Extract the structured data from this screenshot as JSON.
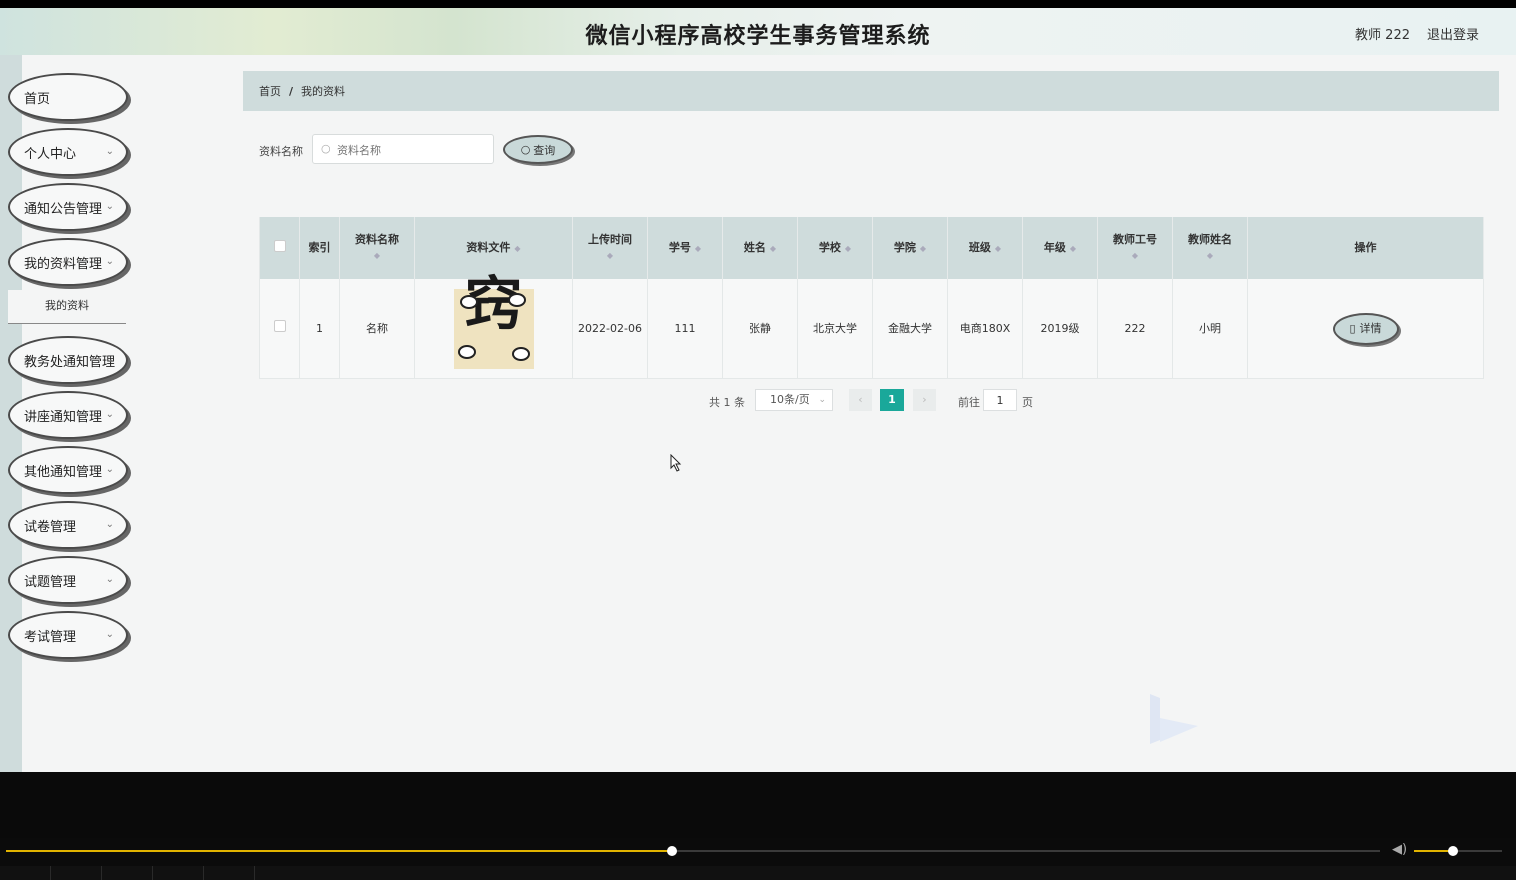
{
  "header": {
    "title": "微信小程序高校学生事务管理系统",
    "user": "教师 222",
    "logout": "退出登录"
  },
  "sidebar": {
    "items": [
      {
        "label": "首页",
        "has_children": false
      },
      {
        "label": "个人中心",
        "has_children": true
      },
      {
        "label": "通知公告管理",
        "has_children": true
      },
      {
        "label": "我的资料管理",
        "has_children": true
      },
      {
        "label": "教务处通知管理",
        "has_children": true
      },
      {
        "label": "讲座通知管理",
        "has_children": true
      },
      {
        "label": "其他通知管理",
        "has_children": true
      },
      {
        "label": "试卷管理",
        "has_children": true
      },
      {
        "label": "试题管理",
        "has_children": true
      },
      {
        "label": "考试管理",
        "has_children": true
      }
    ],
    "submenu": {
      "label": "我的资料"
    }
  },
  "breadcrumb": {
    "home": "首页",
    "separator": "/",
    "current": "我的资料"
  },
  "search": {
    "label": "资料名称",
    "placeholder": "资料名称",
    "button": "查询"
  },
  "table": {
    "headers": [
      "索引",
      "资料名称",
      "资料文件",
      "上传时间",
      "学号",
      "姓名",
      "学校",
      "学院",
      "班级",
      "年级",
      "教师工号",
      "教师姓名",
      "操作"
    ],
    "rows": [
      {
        "index": "1",
        "name": "名称",
        "file_glyph": "窍",
        "upload_time": "2022-02-06",
        "student_no": "111",
        "student_name": "张静",
        "school": "北京大学",
        "college": "金融大学",
        "class": "电商180X",
        "grade": "2019级",
        "teacher_no": "222",
        "teacher_name": "小明",
        "action": "详情"
      }
    ]
  },
  "pagination": {
    "total": "共 1 条",
    "page_size": "10条/页",
    "current_page": "1",
    "goto_prefix": "前往",
    "goto_value": "1",
    "goto_suffix": "页"
  },
  "player": {
    "progress": 0.485,
    "volume": 0.44,
    "accent": "#e1b300"
  },
  "colors": {
    "accent": "#1aa89a",
    "panel": "#cfdcdc"
  }
}
